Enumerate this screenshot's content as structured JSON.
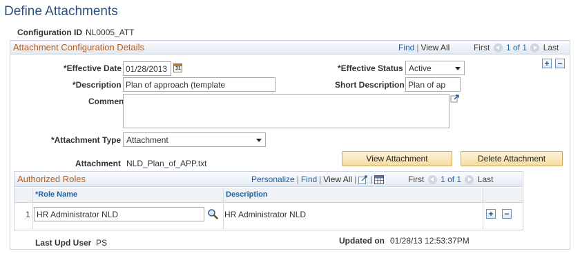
{
  "page": {
    "title": "Define Attachments",
    "config_id_label": "Configuration ID",
    "config_id_value": "NL0005_ATT"
  },
  "details": {
    "title": "Attachment Configuration Details",
    "nav": {
      "find": "Find",
      "view_all": "View All",
      "first": "First",
      "count": "1 of 1",
      "last": "Last"
    },
    "effective_date_label": "*Effective Date",
    "effective_date_value": "01/28/2013",
    "effective_status_label": "*Effective Status",
    "effective_status_value": "Active",
    "description_label": "*Description",
    "description_value": "Plan of approach (template",
    "short_description_label": "Short Description",
    "short_description_value": "Plan of ap",
    "comments_label": "Comments",
    "comments_value": "",
    "attachment_type_label": "*Attachment Type",
    "attachment_type_value": "Attachment",
    "attachment_label": "Attachment",
    "attachment_value": "NLD_Plan_of_APP.txt",
    "view_attachment_label": "View Attachment",
    "delete_attachment_label": "Delete Attachment",
    "add_symbol": "+",
    "remove_symbol": "−"
  },
  "roles": {
    "title": "Authorized Roles",
    "nav": {
      "personalize": "Personalize",
      "find": "Find",
      "view_all": "View All",
      "first": "First",
      "count": "1 of 1",
      "last": "Last"
    },
    "columns": [
      "*Role Name",
      "Description"
    ],
    "rows": [
      {
        "num": "1",
        "role_name": "HR Administrator NLD",
        "description": "HR Administrator NLD"
      }
    ]
  },
  "footer": {
    "last_upd_user_label": "Last Upd User",
    "last_upd_user_value": "PS",
    "updated_on_label": "Updated on",
    "updated_on_value": "01/28/13 12:53:37PM"
  },
  "icons": {
    "calendar": "calendar-icon",
    "expand": "expand-icon",
    "lookup": "magnifier-icon",
    "zoom": "zoom-icon",
    "download": "spreadsheet-icon"
  },
  "colors": {
    "title": "#2b4f7a",
    "group_title": "#b35c1e",
    "link": "#1f5f9e",
    "button": "#f6dca0"
  }
}
